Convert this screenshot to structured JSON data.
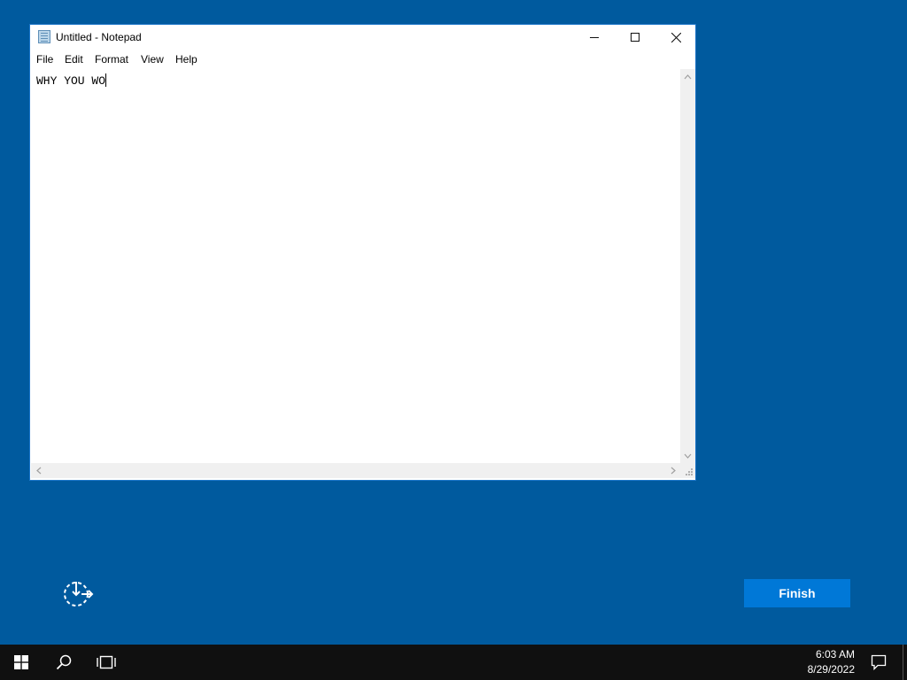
{
  "notepad": {
    "title": "Untitled - Notepad",
    "menu": [
      "File",
      "Edit",
      "Format",
      "View",
      "Help"
    ],
    "content": "WHY YOU WO"
  },
  "setup": {
    "finish_label": "Finish",
    "accessibility_icon": "ease-of-access-icon",
    "accent_color": "#0078d7",
    "background_color": "#005a9e"
  },
  "taskbar": {
    "icons": [
      "windows-start-icon",
      "search-icon",
      "task-view-icon",
      "action-center-icon"
    ],
    "time": "6:03 AM",
    "date": "8/29/2022"
  }
}
